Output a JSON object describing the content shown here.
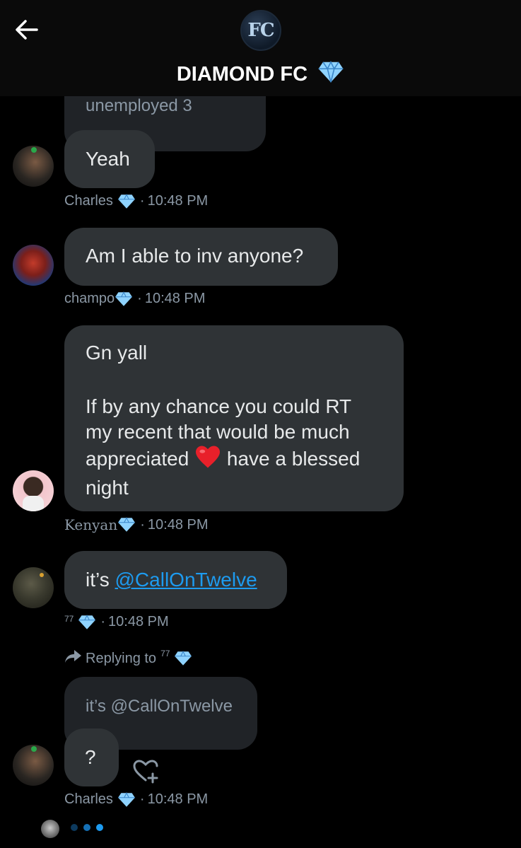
{
  "header": {
    "title": "DIAMOND FC",
    "avatar_text": "FC"
  },
  "messages": [
    {
      "quoted_text": "unemployed 3"
    },
    {
      "text": "Yeah",
      "sender": "Charles",
      "time": "10:48 PM"
    },
    {
      "text": "Am I able to inv anyone?",
      "sender": "champo",
      "time": "10:48 PM"
    },
    {
      "line1": "Gn yall",
      "line2": "If by any chance you could RT",
      "line3": "my recent that would be much",
      "line4a": "appreciated",
      "line4b": "have a blessed",
      "line5": "night",
      "sender": "Kenyan",
      "time": "10:48 PM"
    },
    {
      "prefix": "it’s ",
      "mention": "@CallOnTwelve",
      "sender": "77",
      "time": "10:48 PM"
    },
    {
      "reply_label": "Replying to",
      "reply_to": "77",
      "quoted_text": "it’s @CallOnTwelve",
      "text": "?",
      "sender": "Charles",
      "time": "10:48 PM"
    }
  ],
  "colors": {
    "bubble": "#2f3336",
    "quoted_bubble": "#202327",
    "meta": "#8b98a5",
    "link": "#1d9bf0",
    "diamond": "#8fd3ff"
  }
}
